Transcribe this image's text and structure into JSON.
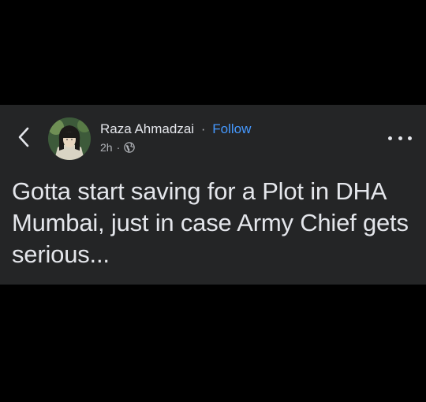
{
  "post": {
    "author": {
      "name": "Raza Ahmadzai",
      "separator": "·",
      "follow_label": "Follow"
    },
    "meta": {
      "time": "2h",
      "separator": "·",
      "audience_icon": "globe-icon"
    },
    "text": "Gotta start saving for a Plot in DHA Mumbai, just in case Army Chief gets serious...",
    "icons": {
      "back": "chevron-left-icon",
      "more": "more-options-icon"
    }
  },
  "colors": {
    "page_background": "#000000",
    "card_background": "#242526",
    "primary_text": "#e4e6eb",
    "secondary_text": "#b0b3b8",
    "link": "#4599ff"
  }
}
